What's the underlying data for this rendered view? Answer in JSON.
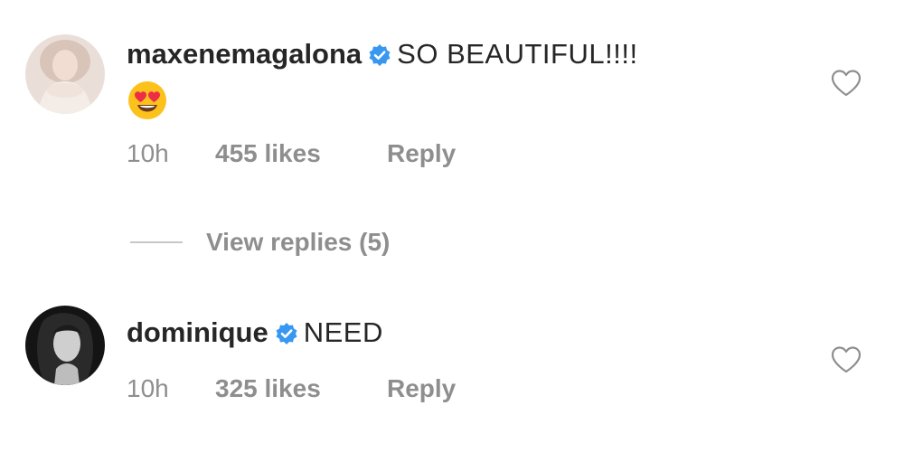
{
  "comments": [
    {
      "username": "maxenemagalona",
      "verified": true,
      "text": "SO BEAUTIFUL!!!!",
      "emoji": "heart-eyes-emoji",
      "time": "10h",
      "likes": "455 likes",
      "reply_label": "Reply"
    },
    {
      "username": "dominique",
      "verified": true,
      "text": "NEED",
      "time": "10h",
      "likes": "325 likes",
      "reply_label": "Reply"
    }
  ],
  "view_replies": {
    "label": "View replies (5)"
  },
  "colors": {
    "text_primary": "#262626",
    "text_secondary": "#8e8e8e",
    "verified_blue": "#3897f0",
    "divider": "#c7c7c7"
  },
  "icons": {
    "verified": "verified-badge-icon",
    "like": "heart-outline-icon"
  }
}
